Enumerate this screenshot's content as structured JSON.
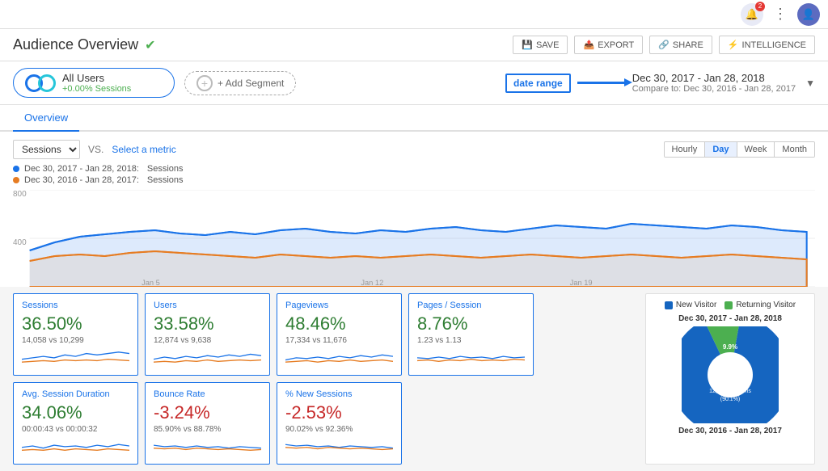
{
  "topnav": {
    "notification_badge": "2",
    "icons": {
      "bell": "🔔",
      "dots": "⋮",
      "avatar": "👤"
    }
  },
  "header": {
    "title": "Audience Overview",
    "verified": "✔",
    "save_label": "SAVE",
    "export_label": "EXPORT",
    "share_label": "SHARE",
    "intelligence_label": "INTELLIGENCE"
  },
  "segment": {
    "name": "All Users",
    "sessions": "+0.00% Sessions",
    "add_segment_label": "+ Add Segment"
  },
  "date_annotation": {
    "label": "date range"
  },
  "date_range": {
    "main": "Dec 30, 2017 - Jan 28, 2018",
    "compare": "Compare to: Dec 30, 2016 - Jan 28, 2017"
  },
  "tabs": {
    "overview": "Overview"
  },
  "chart": {
    "metric1": "Sessions",
    "vs": "VS.",
    "select_metric": "Select a metric",
    "time_buttons": [
      "Hourly",
      "Day",
      "Week",
      "Month"
    ],
    "active_time": "Day",
    "y_label": "800",
    "y_mid": "400",
    "legend": [
      {
        "range": "Dec 30, 2017 - Jan 28, 2018:",
        "metric": "Sessions",
        "color": "blue"
      },
      {
        "range": "Dec 30, 2016 - Jan 28, 2017:",
        "metric": "Sessions",
        "color": "orange"
      }
    ],
    "x_labels": [
      "Jan 5",
      "Jan 12",
      "Jan 19"
    ]
  },
  "stats": [
    {
      "label": "Sessions",
      "value": "36.50%",
      "value_class": "green",
      "sub": "14,058 vs 10,299",
      "highlighted": true
    },
    {
      "label": "Users",
      "value": "33.58%",
      "value_class": "green",
      "sub": "12,874 vs 9,638",
      "highlighted": true
    },
    {
      "label": "Pageviews",
      "value": "48.46%",
      "value_class": "green",
      "sub": "17,334 vs 11,676",
      "highlighted": true
    },
    {
      "label": "Pages / Session",
      "value": "8.76%",
      "value_class": "green",
      "sub": "1.23 vs 1.13",
      "highlighted": true
    },
    {
      "label": "Avg. Session Duration",
      "value": "34.06%",
      "value_class": "green",
      "sub": "00:00:43 vs 00:00:32",
      "highlighted": true
    },
    {
      "label": "Bounce Rate",
      "value": "-3.24%",
      "value_class": "red",
      "sub": "85.90% vs 88.78%",
      "highlighted": true
    },
    {
      "label": "% New Sessions",
      "value": "-2.53%",
      "value_class": "red",
      "sub": "90.02% vs 92.36%",
      "highlighted": true
    }
  ],
  "pie": {
    "legend": [
      {
        "label": "New Visitor",
        "color": "blue"
      },
      {
        "label": "Returning Visitor",
        "color": "green"
      }
    ],
    "title1": "Dec 30, 2017 - Jan 28, 2018",
    "new_visitor_label": "New Visitor\n12,662 Sessions (90.1%)",
    "new_visitor_pct": "9.9%",
    "title2": "Dec 30, 2016 - Jan 28, 2017"
  }
}
